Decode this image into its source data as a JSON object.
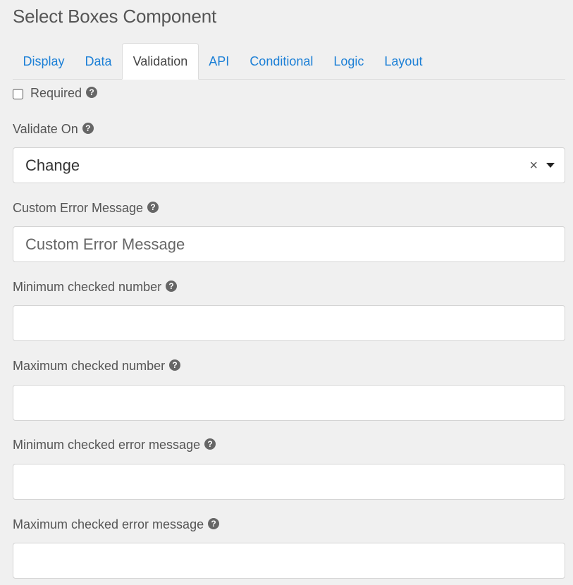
{
  "page": {
    "title": "Select Boxes Component"
  },
  "tabs": [
    {
      "label": "Display",
      "active": false
    },
    {
      "label": "Data",
      "active": false
    },
    {
      "label": "Validation",
      "active": true
    },
    {
      "label": "API",
      "active": false
    },
    {
      "label": "Conditional",
      "active": false
    },
    {
      "label": "Logic",
      "active": false
    },
    {
      "label": "Layout",
      "active": false
    }
  ],
  "form": {
    "required": {
      "label": "Required",
      "checked": false,
      "help_icon": "?"
    },
    "validate_on": {
      "label": "Validate On",
      "value": "Change",
      "clear_glyph": "×",
      "help_icon": "?"
    },
    "custom_error": {
      "label": "Custom Error Message",
      "placeholder": "Custom Error Message",
      "value": "",
      "help_icon": "?"
    },
    "min_checked": {
      "label": "Minimum checked number",
      "value": "",
      "help_icon": "?"
    },
    "max_checked": {
      "label": "Maximum checked number",
      "value": "",
      "help_icon": "?"
    },
    "min_checked_error": {
      "label": "Minimum checked error message",
      "value": "",
      "help_icon": "?"
    },
    "max_checked_error": {
      "label": "Maximum checked error message",
      "value": "",
      "help_icon": "?"
    }
  },
  "icons": {
    "help": "question-circle-icon",
    "clear": "close-icon",
    "dropdown": "caret-down-icon"
  },
  "colors": {
    "link": "#1b7fd6",
    "background": "#f0f0f0",
    "help_icon": "#666666"
  }
}
